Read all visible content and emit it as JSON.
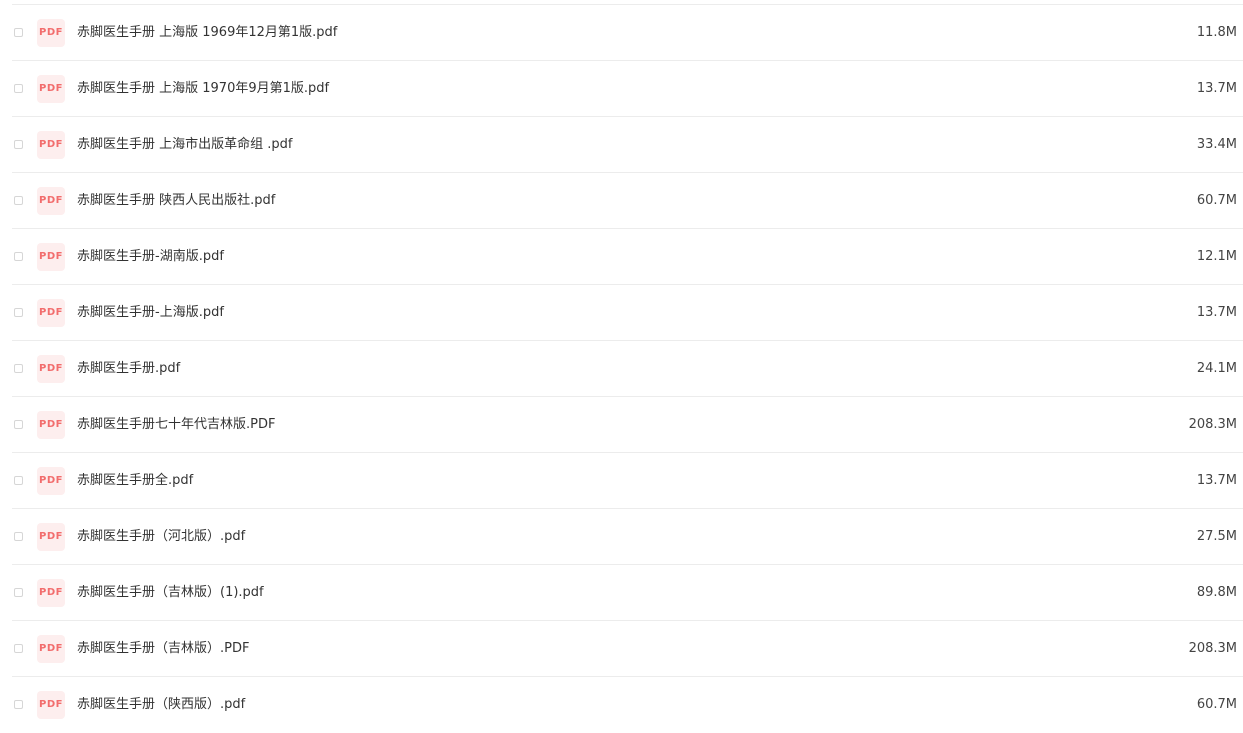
{
  "file_list": {
    "icon_label": "PDF",
    "icon_name": "pdf-file-icon",
    "colors": {
      "icon_bg": "#fdeeee",
      "icon_text": "#f26d6d",
      "row_border": "#ececec"
    },
    "files": [
      {
        "name": "赤脚医生手册 上海版 1969年12月第1版.pdf",
        "size": "11.8M"
      },
      {
        "name": "赤脚医生手册 上海版 1970年9月第1版.pdf",
        "size": "13.7M"
      },
      {
        "name": "赤脚医生手册 上海市出版革命组 .pdf",
        "size": "33.4M"
      },
      {
        "name": "赤脚医生手册 陕西人民出版社.pdf",
        "size": "60.7M"
      },
      {
        "name": "赤脚医生手册-湖南版.pdf",
        "size": "12.1M"
      },
      {
        "name": "赤脚医生手册-上海版.pdf",
        "size": "13.7M"
      },
      {
        "name": "赤脚医生手册.pdf",
        "size": "24.1M"
      },
      {
        "name": "赤脚医生手册七十年代吉林版.PDF",
        "size": "208.3M"
      },
      {
        "name": "赤脚医生手册全.pdf",
        "size": "13.7M"
      },
      {
        "name": "赤脚医生手册（河北版）.pdf",
        "size": "27.5M"
      },
      {
        "name": "赤脚医生手册（吉林版）(1).pdf",
        "size": "89.8M"
      },
      {
        "name": "赤脚医生手册（吉林版）.PDF",
        "size": "208.3M"
      },
      {
        "name": "赤脚医生手册（陕西版）.pdf",
        "size": "60.7M"
      }
    ]
  }
}
